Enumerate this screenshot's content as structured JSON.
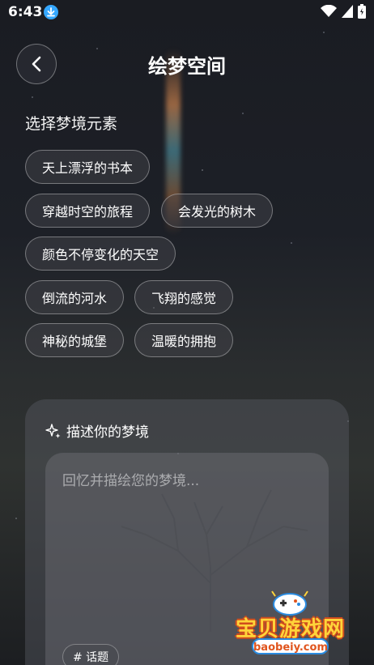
{
  "status_bar": {
    "time": "6:43",
    "icons": [
      "download-icon",
      "wifi-icon",
      "signal-icon",
      "battery-icon"
    ]
  },
  "header": {
    "title": "绘梦空间",
    "back_icon": "chevron-left-icon"
  },
  "elements_section": {
    "heading": "选择梦境元素",
    "chips": [
      "天上漂浮的书本",
      "穿越时空的旅程",
      "会发光的树木",
      "颜色不停变化的天空",
      "倒流的河水",
      "飞翔的感觉",
      "神秘的城堡",
      "温暖的拥抱"
    ]
  },
  "dream_card": {
    "heading": "描述你的梦境",
    "heading_icon": "sparkle-icon",
    "input_placeholder": "回忆并描绘您的梦境...",
    "input_value": "",
    "topic_button": "# 话题"
  },
  "watermark": {
    "title": "宝贝游戏网",
    "subtitle": "baobeiy.com"
  },
  "colors": {
    "text": "#ffffff",
    "chip_border": "rgba(255,255,255,0.35)",
    "watermark_yellow": "#ffd43a"
  }
}
